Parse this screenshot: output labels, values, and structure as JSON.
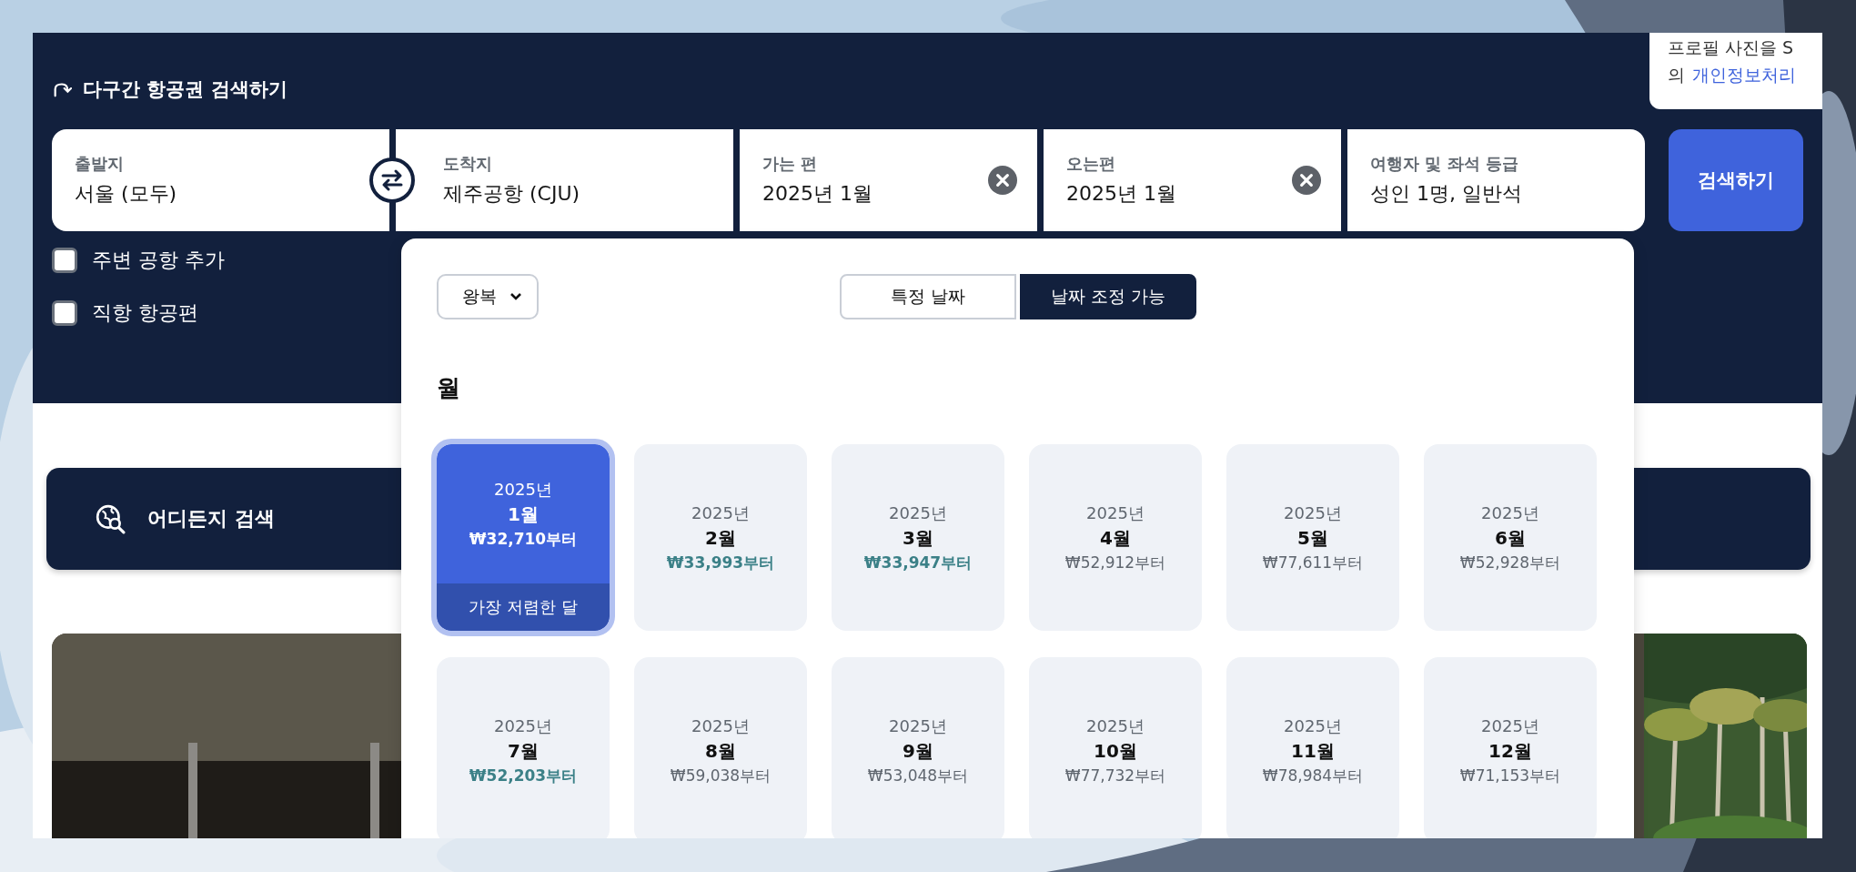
{
  "header": {
    "title": "다구간 항공권 검색하기"
  },
  "fields": [
    {
      "label": "출발지",
      "value": "서울 (모두)",
      "clearable": false
    },
    {
      "label": "도착지",
      "value": "제주공항 (CJU)",
      "clearable": false
    },
    {
      "label": "가는 편",
      "value": "2025년 1월",
      "clearable": true
    },
    {
      "label": "오는편",
      "value": "2025년 1월",
      "clearable": true
    },
    {
      "label": "여행자 및 좌석 등급",
      "value": "성인 1명, 일반석",
      "clearable": false
    }
  ],
  "search_button": "검색하기",
  "options": [
    {
      "label": "주변 공항 추가",
      "checked": false
    },
    {
      "label": "직항 항공편",
      "checked": false
    }
  ],
  "tooltip": {
    "line_1": "프로필 사진을 S",
    "line_2_start": "의",
    "link": "개인정보처리"
  },
  "anywhere_search": "어디든지 검색",
  "date_picker": {
    "trip_type": "왕복",
    "modes": [
      {
        "label": "특정 날짜",
        "selected": false
      },
      {
        "label": "날짜 조정 가능",
        "selected": true
      }
    ],
    "heading": "월",
    "months": [
      {
        "year": "2025년",
        "month": "1월",
        "price": "₩32,710부터",
        "cheap": true,
        "selected": true,
        "badge": "가장 저렴한 달"
      },
      {
        "year": "2025년",
        "month": "2월",
        "price": "₩33,993부터",
        "cheap": true,
        "selected": false
      },
      {
        "year": "2025년",
        "month": "3월",
        "price": "₩33,947부터",
        "cheap": true,
        "selected": false
      },
      {
        "year": "2025년",
        "month": "4월",
        "price": "₩52,912부터",
        "cheap": false,
        "selected": false
      },
      {
        "year": "2025년",
        "month": "5월",
        "price": "₩77,611부터",
        "cheap": false,
        "selected": false
      },
      {
        "year": "2025년",
        "month": "6월",
        "price": "₩52,928부터",
        "cheap": false,
        "selected": false
      },
      {
        "year": "2025년",
        "month": "7월",
        "price": "₩52,203부터",
        "cheap": true,
        "selected": false
      },
      {
        "year": "2025년",
        "month": "8월",
        "price": "₩59,038부터",
        "cheap": false,
        "selected": false
      },
      {
        "year": "2025년",
        "month": "9월",
        "price": "₩53,048부터",
        "cheap": false,
        "selected": false
      },
      {
        "year": "2025년",
        "month": "10월",
        "price": "₩77,732부터",
        "cheap": false,
        "selected": false
      },
      {
        "year": "2025년",
        "month": "11월",
        "price": "₩78,984부터",
        "cheap": false,
        "selected": false
      },
      {
        "year": "2025년",
        "month": "12월",
        "price": "₩71,153부터",
        "cheap": false,
        "selected": false
      }
    ]
  }
}
